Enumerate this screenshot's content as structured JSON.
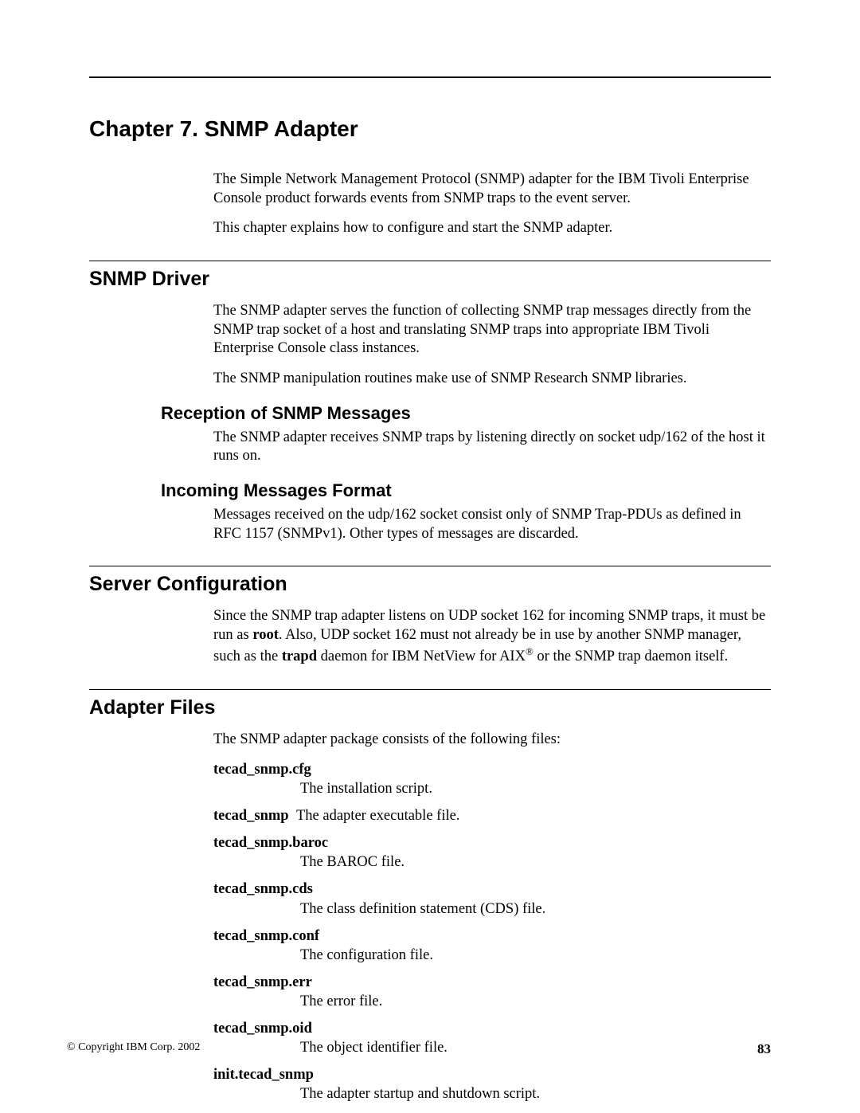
{
  "chapter_title": "Chapter 7. SNMP Adapter",
  "intro": {
    "p1": "The Simple Network Management Protocol (SNMP) adapter for the IBM Tivoli Enterprise Console product forwards events from SNMP traps to the event server.",
    "p2": "This chapter explains how to configure and start the SNMP adapter."
  },
  "snmp_driver": {
    "heading": "SNMP Driver",
    "p1": "The SNMP adapter serves the function of collecting SNMP trap messages directly from the SNMP trap socket of a host and translating SNMP traps into appropriate IBM Tivoli Enterprise Console class instances.",
    "p2": "The SNMP manipulation routines make use of SNMP Research SNMP libraries.",
    "reception": {
      "heading": "Reception of SNMP Messages",
      "p1": "The SNMP adapter receives SNMP traps by listening directly on socket udp/162 of the host it runs on."
    },
    "incoming": {
      "heading": "Incoming Messages Format",
      "p1": "Messages received on the udp/162 socket consist only of SNMP Trap-PDUs as defined in RFC 1157 (SNMPv1). Other types of messages are discarded."
    }
  },
  "server_config": {
    "heading": "Server Configuration",
    "p1a": "Since the SNMP trap adapter listens on UDP socket 162 for incoming SNMP traps, it must be run as ",
    "p1_root": "root",
    "p1b": ". Also, UDP socket 162 must not already be in use by another SNMP manager, such as the ",
    "p1_trapd": "trapd",
    "p1c": " daemon for IBM NetView for AIX",
    "p1d": " or the SNMP trap daemon itself."
  },
  "adapter_files": {
    "heading": "Adapter Files",
    "intro": "The SNMP adapter package consists of the following files:",
    "items": [
      {
        "term": "tecad_snmp.cfg",
        "def": "The installation script.",
        "inline": false
      },
      {
        "term": "tecad_snmp",
        "def": "The adapter executable file.",
        "inline": true
      },
      {
        "term": "tecad_snmp.baroc",
        "def": "The BAROC file.",
        "inline": false
      },
      {
        "term": "tecad_snmp.cds",
        "def": "The class definition statement (CDS) file.",
        "inline": false
      },
      {
        "term": "tecad_snmp.conf",
        "def": "The configuration file.",
        "inline": false
      },
      {
        "term": "tecad_snmp.err",
        "def": "The error file.",
        "inline": false
      },
      {
        "term": "tecad_snmp.oid",
        "def": "The object identifier file.",
        "inline": false
      },
      {
        "term": "init.tecad_snmp",
        "def": "The adapter startup and shutdown script.",
        "inline": false
      }
    ]
  },
  "footer": {
    "copyright": "© Copyright IBM Corp. 2002",
    "page_number": "83"
  }
}
